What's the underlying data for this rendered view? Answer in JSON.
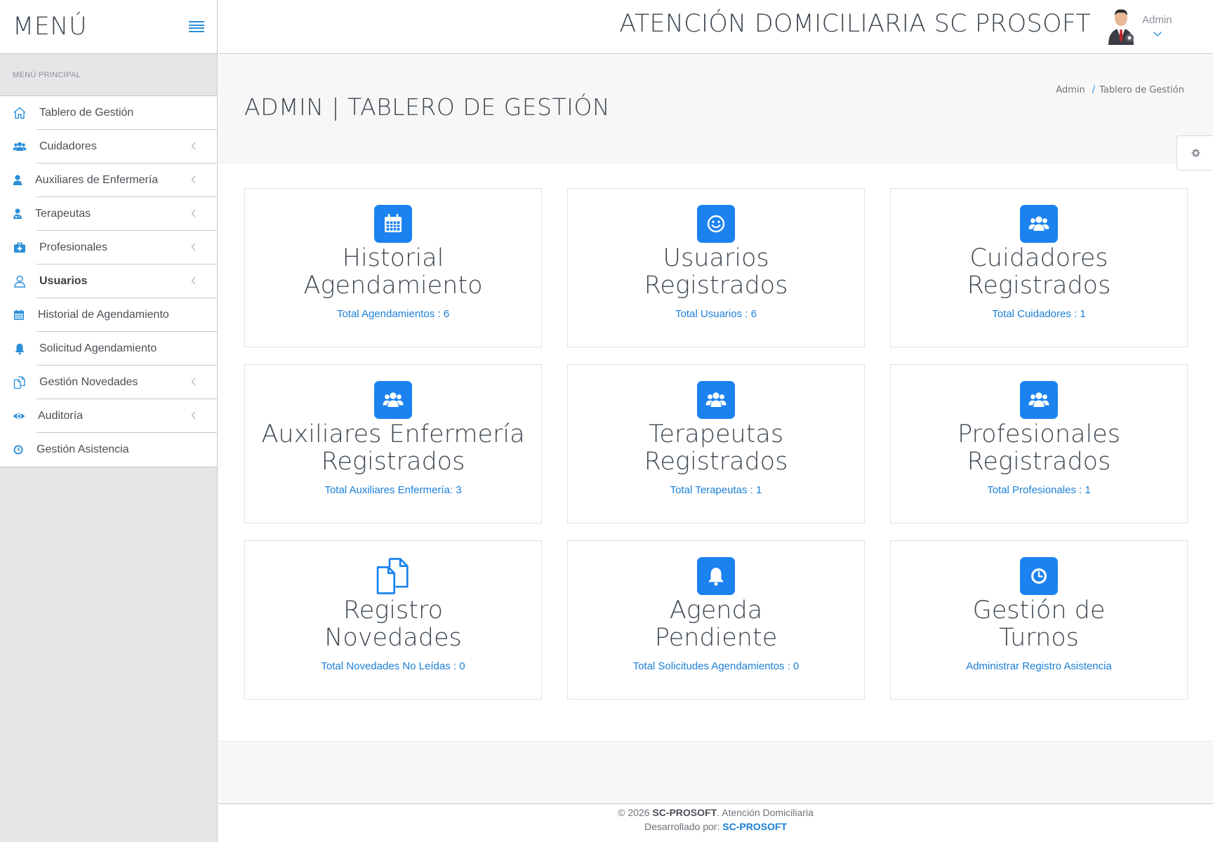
{
  "sidebar": {
    "title": "MENÚ",
    "section_label": "MENÚ PRINCIPAL",
    "items": [
      {
        "label": "Tablero de Gestión",
        "icon": "home-icon"
      },
      {
        "label": "Cuidadores",
        "icon": "users-icon"
      },
      {
        "label": "Auxiliares de Enfermería",
        "icon": "user-icon"
      },
      {
        "label": "Terapeutas",
        "icon": "user-md-icon"
      },
      {
        "label": "Profesionales",
        "icon": "medkit-icon"
      },
      {
        "label": "Usuarios",
        "icon": "user-outline-icon"
      },
      {
        "label": "Historial de Agendamiento",
        "icon": "calendar-icon"
      },
      {
        "label": "Solicitud Agendamiento",
        "icon": "bell-icon"
      },
      {
        "label": "Gestión Novedades",
        "icon": "files-icon"
      },
      {
        "label": "Auditoría",
        "icon": "eye-icon"
      },
      {
        "label": "Gestión Asistencia",
        "icon": "clock-icon"
      }
    ]
  },
  "header": {
    "app_title": "ATENCIÓN DOMICILIARIA SC PROSOFT",
    "user_name": "Admin"
  },
  "page": {
    "title": "ADMIN | TABLERO DE GESTIÓN",
    "breadcrumb": [
      "Admin",
      "Tablero de Gestión"
    ]
  },
  "cards": [
    {
      "title_line1": "Historial",
      "title_line2": "Agendamiento",
      "subtitle": "Total Agendamientos : 6",
      "icon": "calendar-icon"
    },
    {
      "title_line1": "Usuarios",
      "title_line2": "Registrados",
      "subtitle": "Total Usuarios : 6",
      "icon": "smile-icon"
    },
    {
      "title_line1": "Cuidadores",
      "title_line2": "Registrados",
      "subtitle": "Total Cuidadores : 1",
      "icon": "users-icon"
    },
    {
      "title_line1": "Auxiliares Enfermería",
      "title_line2": "Registrados",
      "subtitle": "Total Auxiliares Enfermería: 3",
      "icon": "users-icon"
    },
    {
      "title_line1": "Terapeutas",
      "title_line2": "Registrados",
      "subtitle": "Total Terapeutas : 1",
      "icon": "users-icon"
    },
    {
      "title_line1": "Profesionales",
      "title_line2": "Registrados",
      "subtitle": "Total Profesionales : 1",
      "icon": "users-icon"
    },
    {
      "title_line1": "Registro",
      "title_line2": "Novedades",
      "subtitle": "Total Novedades No Leídas : 0",
      "icon": "files-icon"
    },
    {
      "title_line1": "Agenda",
      "title_line2": "Pendiente",
      "subtitle": "Total Solicitudes Agendamientos : 0",
      "icon": "bell-icon"
    },
    {
      "title_line1": "Gestión de",
      "title_line2": "Turnos",
      "subtitle": "Administrar Registro Asistencia",
      "icon": "clock-icon"
    }
  ],
  "footer": {
    "copyright_prefix": "© 2026",
    "brand": "SC-PROSOFT",
    "copyright_suffix": ". Atención Domiciliaria",
    "developed_label": "Desarrollado por:",
    "developer": "SC-PROSOFT"
  },
  "colors": {
    "accent": "#1b82f0",
    "link": "#1b7fd6",
    "sidebar_bg": "#e6e6e8",
    "text_dark": "#3e4852"
  }
}
